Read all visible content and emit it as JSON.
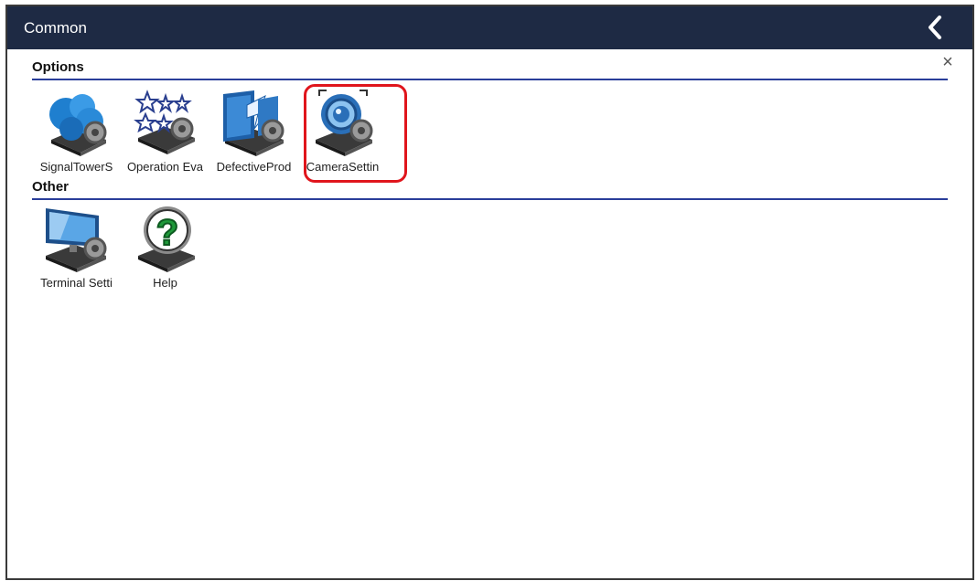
{
  "window": {
    "title": "Common"
  },
  "toolbar": {
    "back_icon": "chevron-left-icon",
    "close_glyph": "×"
  },
  "sections": [
    {
      "title": "Options",
      "items": [
        {
          "label": "SignalTowerS",
          "icon": "signal-tower-settings-icon"
        },
        {
          "label": "Operation Eva",
          "icon": "operation-evaluation-icon"
        },
        {
          "label": "DefectiveProd",
          "icon": "defective-product-icon"
        },
        {
          "label": "CameraSettin",
          "icon": "camera-settings-icon",
          "highlighted": true
        }
      ]
    },
    {
      "title": "Other",
      "items": [
        {
          "label": "Terminal Setti",
          "icon": "terminal-settings-icon"
        },
        {
          "label": "Help",
          "icon": "help-icon"
        }
      ]
    }
  ],
  "colors": {
    "titlebar": "#1e2a44",
    "rule": "#2a3e9a",
    "highlight": "#e0151c"
  }
}
